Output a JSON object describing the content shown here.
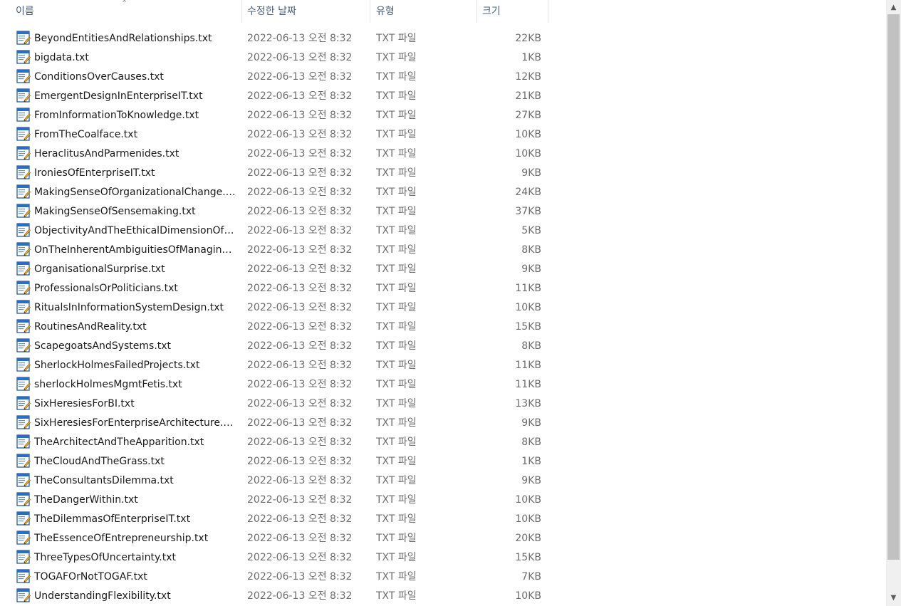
{
  "columns": {
    "name": "이름",
    "modified": "수정한 날짜",
    "type": "유형",
    "size": "크기"
  },
  "files": [
    {
      "name": "BeyondEntitiesAndRelationships.txt",
      "modified": "2022-06-13 오전 8:32",
      "type": "TXT 파일",
      "size": "22KB"
    },
    {
      "name": "bigdata.txt",
      "modified": "2022-06-13 오전 8:32",
      "type": "TXT 파일",
      "size": "1KB"
    },
    {
      "name": "ConditionsOverCauses.txt",
      "modified": "2022-06-13 오전 8:32",
      "type": "TXT 파일",
      "size": "12KB"
    },
    {
      "name": "EmergentDesignInEnterpriseIT.txt",
      "modified": "2022-06-13 오전 8:32",
      "type": "TXT 파일",
      "size": "21KB"
    },
    {
      "name": "FromInformationToKnowledge.txt",
      "modified": "2022-06-13 오전 8:32",
      "type": "TXT 파일",
      "size": "27KB"
    },
    {
      "name": "FromTheCoalface.txt",
      "modified": "2022-06-13 오전 8:32",
      "type": "TXT 파일",
      "size": "10KB"
    },
    {
      "name": "HeraclitusAndParmenides.txt",
      "modified": "2022-06-13 오전 8:32",
      "type": "TXT 파일",
      "size": "10KB"
    },
    {
      "name": "IroniesOfEnterpriseIT.txt",
      "modified": "2022-06-13 오전 8:32",
      "type": "TXT 파일",
      "size": "9KB"
    },
    {
      "name": "MakingSenseOfOrganizationalChange.txt",
      "modified": "2022-06-13 오전 8:32",
      "type": "TXT 파일",
      "size": "24KB"
    },
    {
      "name": "MakingSenseOfSensemaking.txt",
      "modified": "2022-06-13 오전 8:32",
      "type": "TXT 파일",
      "size": "37KB"
    },
    {
      "name": "ObjectivityAndTheEthicalDimensionOfD...",
      "modified": "2022-06-13 오전 8:32",
      "type": "TXT 파일",
      "size": "5KB"
    },
    {
      "name": "OnTheInherentAmbiguitiesOfManaging...",
      "modified": "2022-06-13 오전 8:32",
      "type": "TXT 파일",
      "size": "8KB"
    },
    {
      "name": "OrganisationalSurprise.txt",
      "modified": "2022-06-13 오전 8:32",
      "type": "TXT 파일",
      "size": "9KB"
    },
    {
      "name": "ProfessionalsOrPoliticians.txt",
      "modified": "2022-06-13 오전 8:32",
      "type": "TXT 파일",
      "size": "11KB"
    },
    {
      "name": "RitualsInInformationSystemDesign.txt",
      "modified": "2022-06-13 오전 8:32",
      "type": "TXT 파일",
      "size": "10KB"
    },
    {
      "name": "RoutinesAndReality.txt",
      "modified": "2022-06-13 오전 8:32",
      "type": "TXT 파일",
      "size": "15KB"
    },
    {
      "name": "ScapegoatsAndSystems.txt",
      "modified": "2022-06-13 오전 8:32",
      "type": "TXT 파일",
      "size": "8KB"
    },
    {
      "name": "SherlockHolmesFailedProjects.txt",
      "modified": "2022-06-13 오전 8:32",
      "type": "TXT 파일",
      "size": "11KB"
    },
    {
      "name": "sherlockHolmesMgmtFetis.txt",
      "modified": "2022-06-13 오전 8:32",
      "type": "TXT 파일",
      "size": "11KB"
    },
    {
      "name": "SixHeresiesForBI.txt",
      "modified": "2022-06-13 오전 8:32",
      "type": "TXT 파일",
      "size": "13KB"
    },
    {
      "name": "SixHeresiesForEnterpriseArchitecture.txt",
      "modified": "2022-06-13 오전 8:32",
      "type": "TXT 파일",
      "size": "9KB"
    },
    {
      "name": "TheArchitectAndTheApparition.txt",
      "modified": "2022-06-13 오전 8:32",
      "type": "TXT 파일",
      "size": "8KB"
    },
    {
      "name": "TheCloudAndTheGrass.txt",
      "modified": "2022-06-13 오전 8:32",
      "type": "TXT 파일",
      "size": "1KB"
    },
    {
      "name": "TheConsultantsDilemma.txt",
      "modified": "2022-06-13 오전 8:32",
      "type": "TXT 파일",
      "size": "9KB"
    },
    {
      "name": "TheDangerWithin.txt",
      "modified": "2022-06-13 오전 8:32",
      "type": "TXT 파일",
      "size": "10KB"
    },
    {
      "name": "TheDilemmasOfEnterpriseIT.txt",
      "modified": "2022-06-13 오전 8:32",
      "type": "TXT 파일",
      "size": "10KB"
    },
    {
      "name": "TheEssenceOfEntrepreneurship.txt",
      "modified": "2022-06-13 오전 8:32",
      "type": "TXT 파일",
      "size": "20KB"
    },
    {
      "name": "ThreeTypesOfUncertainty.txt",
      "modified": "2022-06-13 오전 8:32",
      "type": "TXT 파일",
      "size": "15KB"
    },
    {
      "name": "TOGAFOrNotTOGAF.txt",
      "modified": "2022-06-13 오전 8:32",
      "type": "TXT 파일",
      "size": "7KB"
    },
    {
      "name": "UnderstandingFlexibility.txt",
      "modified": "2022-06-13 오전 8:32",
      "type": "TXT 파일",
      "size": "10KB"
    }
  ]
}
